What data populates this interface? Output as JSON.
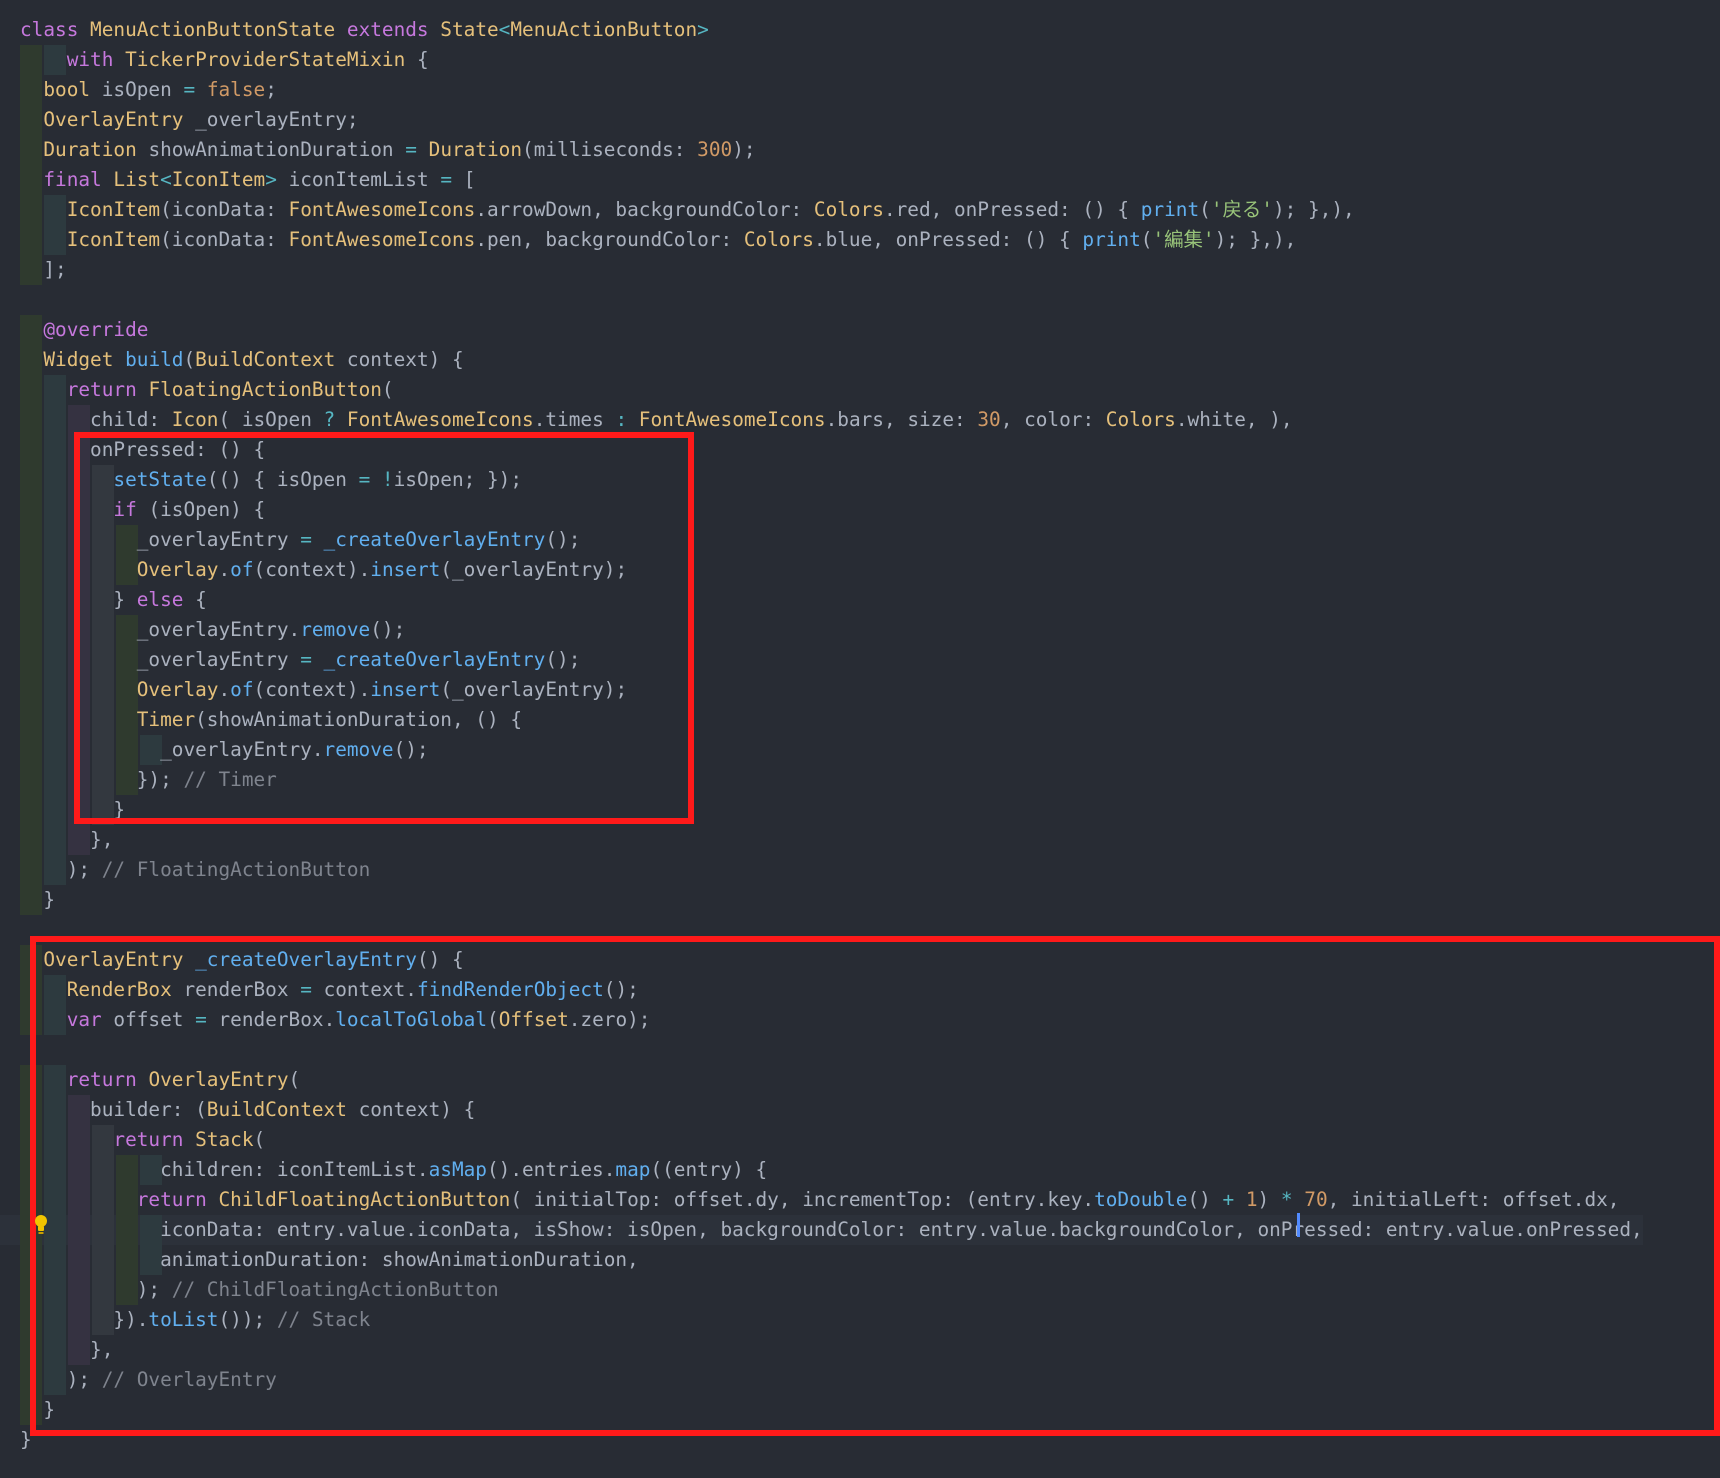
{
  "editor": {
    "lines": [
      [
        {
          "t": "class ",
          "c": "kw"
        },
        {
          "t": "MenuActionButtonState ",
          "c": "ty"
        },
        {
          "t": "extends ",
          "c": "kw"
        },
        {
          "t": "State",
          "c": "ty"
        },
        {
          "t": "<",
          "c": "op"
        },
        {
          "t": "MenuActionButton",
          "c": "ty"
        },
        {
          "t": ">",
          "c": "op"
        }
      ],
      [
        {
          "t": "    "
        },
        {
          "t": "with ",
          "c": "kw"
        },
        {
          "t": "TickerProviderStateMixin",
          "c": "ty"
        },
        {
          "t": " {"
        }
      ],
      [
        {
          "t": "  "
        },
        {
          "t": "bool ",
          "c": "ty"
        },
        {
          "t": "isOpen "
        },
        {
          "t": "= ",
          "c": "op"
        },
        {
          "t": "false",
          "c": "nu"
        },
        {
          "t": ";"
        }
      ],
      [
        {
          "t": "  "
        },
        {
          "t": "OverlayEntry ",
          "c": "ty"
        },
        {
          "t": "_overlayEntry;"
        }
      ],
      [
        {
          "t": "  "
        },
        {
          "t": "Duration ",
          "c": "ty"
        },
        {
          "t": "showAnimationDuration "
        },
        {
          "t": "= ",
          "c": "op"
        },
        {
          "t": "Duration",
          "c": "ty"
        },
        {
          "t": "(milliseconds: "
        },
        {
          "t": "300",
          "c": "nu"
        },
        {
          "t": ");"
        }
      ],
      [
        {
          "t": "  "
        },
        {
          "t": "final ",
          "c": "kw"
        },
        {
          "t": "List",
          "c": "ty"
        },
        {
          "t": "<",
          "c": "op"
        },
        {
          "t": "IconItem",
          "c": "ty"
        },
        {
          "t": "> ",
          "c": "op"
        },
        {
          "t": "iconItemList "
        },
        {
          "t": "= ",
          "c": "op"
        },
        {
          "t": "["
        }
      ],
      [
        {
          "t": "    "
        },
        {
          "t": "IconItem",
          "c": "ty"
        },
        {
          "t": "(iconData: "
        },
        {
          "t": "FontAwesomeIcons",
          "c": "ty"
        },
        {
          "t": ".arrowDown, backgroundColor: "
        },
        {
          "t": "Colors",
          "c": "ty"
        },
        {
          "t": ".red, onPressed: () { "
        },
        {
          "t": "print",
          "c": "fn"
        },
        {
          "t": "("
        },
        {
          "t": "'戻る'",
          "c": "st"
        },
        {
          "t": "); },),"
        }
      ],
      [
        {
          "t": "    "
        },
        {
          "t": "IconItem",
          "c": "ty"
        },
        {
          "t": "(iconData: "
        },
        {
          "t": "FontAwesomeIcons",
          "c": "ty"
        },
        {
          "t": ".pen, backgroundColor: "
        },
        {
          "t": "Colors",
          "c": "ty"
        },
        {
          "t": ".blue, onPressed: () { "
        },
        {
          "t": "print",
          "c": "fn"
        },
        {
          "t": "("
        },
        {
          "t": "'編集'",
          "c": "st"
        },
        {
          "t": "); },),"
        }
      ],
      [
        {
          "t": "  ];"
        }
      ],
      [],
      [
        {
          "t": "  "
        },
        {
          "t": "@override",
          "c": "kw"
        }
      ],
      [
        {
          "t": "  "
        },
        {
          "t": "Widget ",
          "c": "ty"
        },
        {
          "t": "build",
          "c": "fn"
        },
        {
          "t": "("
        },
        {
          "t": "BuildContext ",
          "c": "ty"
        },
        {
          "t": "context) {"
        }
      ],
      [
        {
          "t": "    "
        },
        {
          "t": "return ",
          "c": "kw"
        },
        {
          "t": "FloatingActionButton",
          "c": "ty"
        },
        {
          "t": "("
        }
      ],
      [
        {
          "t": "      child: "
        },
        {
          "t": "Icon",
          "c": "ty"
        },
        {
          "t": "( isOpen "
        },
        {
          "t": "? ",
          "c": "op"
        },
        {
          "t": "FontAwesomeIcons",
          "c": "ty"
        },
        {
          "t": ".times "
        },
        {
          "t": ": ",
          "c": "op"
        },
        {
          "t": "FontAwesomeIcons",
          "c": "ty"
        },
        {
          "t": ".bars, size: "
        },
        {
          "t": "30",
          "c": "nu"
        },
        {
          "t": ", color: "
        },
        {
          "t": "Colors",
          "c": "ty"
        },
        {
          "t": ".white, ),"
        }
      ],
      [
        {
          "t": "      onPressed: () {"
        }
      ],
      [
        {
          "t": "        "
        },
        {
          "t": "setState",
          "c": "fn"
        },
        {
          "t": "(() { isOpen "
        },
        {
          "t": "= !",
          "c": "op"
        },
        {
          "t": "isOpen; });"
        }
      ],
      [
        {
          "t": "        "
        },
        {
          "t": "if ",
          "c": "kw"
        },
        {
          "t": "(isOpen) {"
        }
      ],
      [
        {
          "t": "          _overlayEntry "
        },
        {
          "t": "= ",
          "c": "op"
        },
        {
          "t": "_createOverlayEntry",
          "c": "fn"
        },
        {
          "t": "();"
        }
      ],
      [
        {
          "t": "          "
        },
        {
          "t": "Overlay",
          "c": "ty"
        },
        {
          "t": "."
        },
        {
          "t": "of",
          "c": "fn"
        },
        {
          "t": "(context)."
        },
        {
          "t": "insert",
          "c": "fn"
        },
        {
          "t": "(_overlayEntry);"
        }
      ],
      [
        {
          "t": "        } "
        },
        {
          "t": "else ",
          "c": "kw"
        },
        {
          "t": "{"
        }
      ],
      [
        {
          "t": "          _overlayEntry."
        },
        {
          "t": "remove",
          "c": "fn"
        },
        {
          "t": "();"
        }
      ],
      [
        {
          "t": "          _overlayEntry "
        },
        {
          "t": "= ",
          "c": "op"
        },
        {
          "t": "_createOverlayEntry",
          "c": "fn"
        },
        {
          "t": "();"
        }
      ],
      [
        {
          "t": "          "
        },
        {
          "t": "Overlay",
          "c": "ty"
        },
        {
          "t": "."
        },
        {
          "t": "of",
          "c": "fn"
        },
        {
          "t": "(context)."
        },
        {
          "t": "insert",
          "c": "fn"
        },
        {
          "t": "(_overlayEntry);"
        }
      ],
      [
        {
          "t": "          "
        },
        {
          "t": "Timer",
          "c": "ty"
        },
        {
          "t": "(showAnimationDuration, () {"
        }
      ],
      [
        {
          "t": "            _overlayEntry."
        },
        {
          "t": "remove",
          "c": "fn"
        },
        {
          "t": "();"
        }
      ],
      [
        {
          "t": "          }); "
        },
        {
          "t": "// Timer",
          "c": "cm"
        }
      ],
      [
        {
          "t": "        }"
        }
      ],
      [
        {
          "t": "      },"
        }
      ],
      [
        {
          "t": "    ); "
        },
        {
          "t": "// FloatingActionButton",
          "c": "cm"
        }
      ],
      [
        {
          "t": "  }"
        }
      ],
      [],
      [
        {
          "t": "  "
        },
        {
          "t": "OverlayEntry ",
          "c": "ty"
        },
        {
          "t": "_createOverlayEntry",
          "c": "fn"
        },
        {
          "t": "() {"
        }
      ],
      [
        {
          "t": "    "
        },
        {
          "t": "RenderBox ",
          "c": "ty"
        },
        {
          "t": "renderBox "
        },
        {
          "t": "= ",
          "c": "op"
        },
        {
          "t": "context."
        },
        {
          "t": "findRenderObject",
          "c": "fn"
        },
        {
          "t": "();"
        }
      ],
      [
        {
          "t": "    "
        },
        {
          "t": "var ",
          "c": "kw"
        },
        {
          "t": "offset "
        },
        {
          "t": "= ",
          "c": "op"
        },
        {
          "t": "renderBox."
        },
        {
          "t": "localToGlobal",
          "c": "fn"
        },
        {
          "t": "("
        },
        {
          "t": "Offset",
          "c": "ty"
        },
        {
          "t": ".zero);"
        }
      ],
      [],
      [
        {
          "t": "    "
        },
        {
          "t": "return ",
          "c": "kw"
        },
        {
          "t": "OverlayEntry",
          "c": "ty"
        },
        {
          "t": "("
        }
      ],
      [
        {
          "t": "      builder: ("
        },
        {
          "t": "BuildContext ",
          "c": "ty"
        },
        {
          "t": "context) {"
        }
      ],
      [
        {
          "t": "        "
        },
        {
          "t": "return ",
          "c": "kw"
        },
        {
          "t": "Stack",
          "c": "ty"
        },
        {
          "t": "("
        }
      ],
      [
        {
          "t": "            children: iconItemList."
        },
        {
          "t": "asMap",
          "c": "fn"
        },
        {
          "t": "().entries."
        },
        {
          "t": "map",
          "c": "fn"
        },
        {
          "t": "((entry) {"
        }
      ],
      [
        {
          "t": "          "
        },
        {
          "t": "return ",
          "c": "kw"
        },
        {
          "t": "ChildFloatingActionButton",
          "c": "ty"
        },
        {
          "t": "( initialTop: offset.dy, incrementTop: (entry.key."
        },
        {
          "t": "toDouble",
          "c": "fn"
        },
        {
          "t": "() "
        },
        {
          "t": "+ ",
          "c": "op"
        },
        {
          "t": "1",
          "c": "nu"
        },
        {
          "t": ") "
        },
        {
          "t": "* ",
          "c": "op"
        },
        {
          "t": "70",
          "c": "nu"
        },
        {
          "t": ", initialLeft: offset.dx,"
        }
      ],
      [
        {
          "t": "            iconData: entry.value.iconData, isShow: isOpen, backgroundColor: entry.value.backgroundColor, onPressed: entry.value.onPressed,"
        }
      ],
      [
        {
          "t": "            animationDuration: showAnimationDuration,"
        }
      ],
      [
        {
          "t": "          ); "
        },
        {
          "t": "// ChildFloatingActionButton",
          "c": "cm"
        }
      ],
      [
        {
          "t": "        })."
        },
        {
          "t": "toList",
          "c": "fn"
        },
        {
          "t": "()); "
        },
        {
          "t": "// Stack",
          "c": "cm"
        }
      ],
      [
        {
          "t": "      },"
        }
      ],
      [
        {
          "t": "    ); "
        },
        {
          "t": "// OverlayEntry",
          "c": "cm"
        }
      ],
      [
        {
          "t": "  }"
        }
      ],
      [
        {
          "t": "}"
        }
      ]
    ],
    "current_line": 40
  },
  "annotation_color": "#ff1a1a"
}
